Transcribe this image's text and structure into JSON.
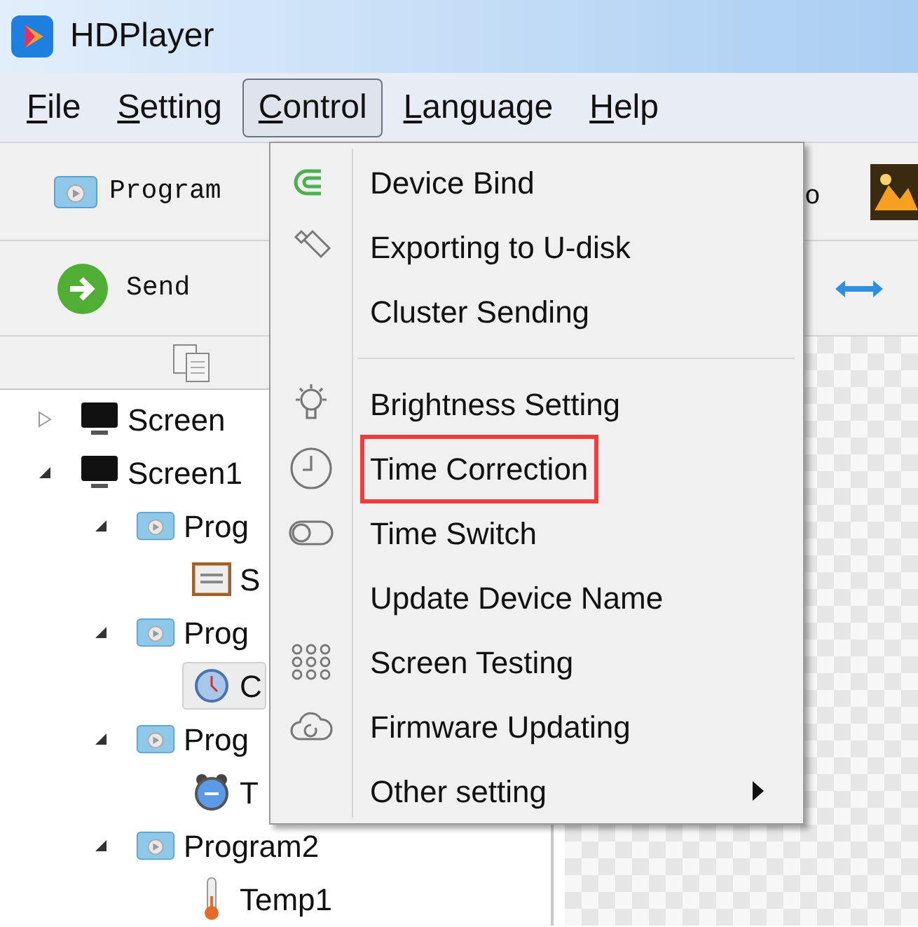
{
  "window": {
    "title": "HDPlayer"
  },
  "menu_bar": [
    {
      "label": "File",
      "selected": false
    },
    {
      "label": "Setting",
      "selected": false
    },
    {
      "label": "Control",
      "selected": true
    },
    {
      "label": "Language",
      "selected": false
    },
    {
      "label": "Help",
      "selected": false
    }
  ],
  "toolbar_buttons": [
    {
      "label": "Program",
      "kind": "program"
    },
    {
      "label": "Send",
      "kind": "send"
    }
  ],
  "toolbar_cut_label": "o",
  "tree": [
    {
      "label": "Screen",
      "kind": "screen",
      "expanded": false,
      "selected": false
    },
    {
      "label": "Screen1",
      "kind": "screen",
      "expanded": true,
      "selected": false,
      "children": [
        {
          "label": "Prog",
          "kind": "program",
          "expanded": true,
          "selected": false,
          "children": [
            {
              "label": "S",
              "kind": "subtitle",
              "selected": false
            }
          ]
        },
        {
          "label": "Prog",
          "kind": "program",
          "expanded": true,
          "selected": false,
          "children": [
            {
              "label": "C",
              "kind": "clock",
              "selected": true
            }
          ]
        },
        {
          "label": "Prog",
          "kind": "program",
          "expanded": true,
          "selected": false,
          "children": [
            {
              "label": "T",
              "kind": "alarm",
              "selected": false
            }
          ]
        },
        {
          "label": "Program2",
          "kind": "program",
          "expanded": true,
          "selected": false,
          "children": [
            {
              "label": "Temp1",
              "kind": "temperature",
              "selected": false
            }
          ]
        }
      ]
    }
  ],
  "dropdown": {
    "groups": [
      [
        {
          "label": "Device Bind",
          "kind": "magnet",
          "marked": false,
          "submenu": false
        },
        {
          "label": "Exporting to U-disk",
          "kind": "usb",
          "marked": false,
          "submenu": false
        },
        {
          "label": "Cluster Sending",
          "kind": "none",
          "marked": false,
          "submenu": false
        }
      ],
      [
        {
          "label": "Brightness Setting",
          "kind": "bulb",
          "marked": false,
          "submenu": false
        },
        {
          "label": "Time Correction",
          "kind": "clock",
          "marked": true,
          "submenu": false
        },
        {
          "label": "Time Switch",
          "kind": "toggle",
          "marked": false,
          "submenu": false
        },
        {
          "label": "Update Device Name",
          "kind": "none",
          "marked": false,
          "submenu": false
        },
        {
          "label": "Screen Testing",
          "kind": "dots",
          "marked": false,
          "submenu": false
        },
        {
          "label": "Firmware Updating",
          "kind": "cloud",
          "marked": false,
          "submenu": false
        },
        {
          "label": "Other setting",
          "kind": "none",
          "marked": false,
          "submenu": true
        }
      ]
    ]
  }
}
